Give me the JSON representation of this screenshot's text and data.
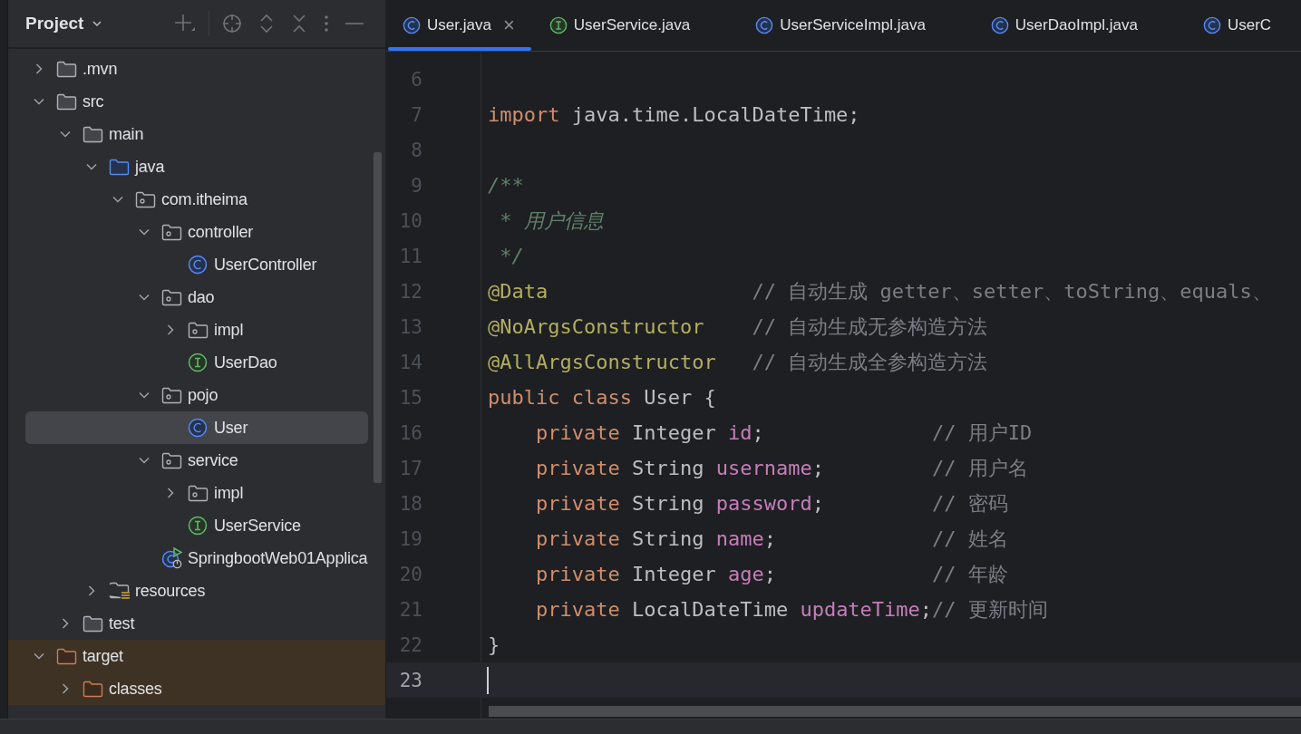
{
  "sidebar": {
    "title": "Project",
    "tree": [
      {
        "label": ".mvn",
        "kind": "folder",
        "expanded": false,
        "selected": false,
        "excluded": false
      },
      {
        "label": "src",
        "kind": "folder",
        "expanded": true,
        "selected": false,
        "excluded": false,
        "children": [
          {
            "label": "main",
            "kind": "folder",
            "expanded": true,
            "selected": false,
            "excluded": false,
            "children": [
              {
                "label": "java",
                "kind": "source",
                "expanded": true,
                "selected": false,
                "excluded": false,
                "children": [
                  {
                    "label": "com.itheima",
                    "kind": "package",
                    "expanded": true,
                    "selected": false,
                    "excluded": false,
                    "children": [
                      {
                        "label": "controller",
                        "kind": "package",
                        "expanded": true,
                        "selected": false,
                        "excluded": false,
                        "children": [
                          {
                            "label": "UserController",
                            "kind": "class",
                            "selected": false,
                            "excluded": false
                          }
                        ]
                      },
                      {
                        "label": "dao",
                        "kind": "package",
                        "expanded": true,
                        "selected": false,
                        "excluded": false,
                        "children": [
                          {
                            "label": "impl",
                            "kind": "package",
                            "expanded": false,
                            "selected": false,
                            "excluded": false
                          },
                          {
                            "label": "UserDao",
                            "kind": "interface",
                            "selected": false,
                            "excluded": false
                          }
                        ]
                      },
                      {
                        "label": "pojo",
                        "kind": "package",
                        "expanded": true,
                        "selected": false,
                        "excluded": false,
                        "children": [
                          {
                            "label": "User",
                            "kind": "class",
                            "selected": true,
                            "excluded": false
                          }
                        ]
                      },
                      {
                        "label": "service",
                        "kind": "package",
                        "expanded": true,
                        "selected": false,
                        "excluded": false,
                        "children": [
                          {
                            "label": "impl",
                            "kind": "package",
                            "expanded": false,
                            "selected": false,
                            "excluded": false
                          },
                          {
                            "label": "UserService",
                            "kind": "interface",
                            "selected": false,
                            "excluded": false
                          }
                        ]
                      },
                      {
                        "label": "SpringbootWeb01Applica",
                        "kind": "app",
                        "selected": false,
                        "excluded": false
                      }
                    ]
                  }
                ]
              },
              {
                "label": "resources",
                "kind": "resources",
                "expanded": false,
                "selected": false,
                "excluded": false
              }
            ]
          },
          {
            "label": "test",
            "kind": "folder",
            "expanded": false,
            "selected": false,
            "excluded": false
          }
        ]
      },
      {
        "label": "target",
        "kind": "folder",
        "expanded": true,
        "selected": false,
        "excluded": true,
        "children": [
          {
            "label": "classes",
            "kind": "folder",
            "expanded": false,
            "selected": false,
            "excluded": true
          }
        ]
      }
    ]
  },
  "tabs": [
    {
      "label": "User.java",
      "kind": "class",
      "selected": true
    },
    {
      "label": "UserService.java",
      "kind": "interface",
      "selected": false
    },
    {
      "label": "UserServiceImpl.java",
      "kind": "class",
      "selected": false
    },
    {
      "label": "UserDaoImpl.java",
      "kind": "class",
      "selected": false
    },
    {
      "label": "UserC",
      "kind": "class",
      "selected": false
    }
  ],
  "close_icon": "×",
  "editor": {
    "lines": [
      {
        "number": "6",
        "current": false
      },
      {
        "number": "7",
        "current": false,
        "tokens": [
          {
            "text": "import",
            "kind": "keyword"
          },
          {
            "text": " java.time.LocalDateTime;",
            "kind": "plain"
          }
        ]
      },
      {
        "number": "8",
        "current": false
      },
      {
        "number": "9",
        "current": false,
        "tokens": [
          {
            "text": "/**",
            "kind": "doc"
          }
        ]
      },
      {
        "number": "10",
        "current": false,
        "tokens": [
          {
            "text": " * 用户信息",
            "kind": "doc"
          }
        ]
      },
      {
        "number": "11",
        "current": false,
        "tokens": [
          {
            "text": " */",
            "kind": "doc"
          }
        ]
      },
      {
        "number": "12",
        "current": false,
        "tokens": [
          {
            "text": "@Data                 ",
            "kind": "annotation"
          },
          {
            "text": "// 自动生成 getter、setter、toString、equals、",
            "kind": "comment"
          }
        ]
      },
      {
        "number": "13",
        "current": false,
        "tokens": [
          {
            "text": "@NoArgsConstructor    ",
            "kind": "annotation"
          },
          {
            "text": "// 自动生成无参构造方法",
            "kind": "comment"
          }
        ]
      },
      {
        "number": "14",
        "current": false,
        "tokens": [
          {
            "text": "@AllArgsConstructor   ",
            "kind": "annotation"
          },
          {
            "text": "// 自动生成全参构造方法",
            "kind": "comment"
          }
        ]
      },
      {
        "number": "15",
        "current": false,
        "tokens": [
          {
            "text": "public class",
            "kind": "keyword"
          },
          {
            "text": " User {",
            "kind": "plain"
          }
        ]
      },
      {
        "number": "16",
        "current": false,
        "tokens": [
          {
            "text": "    private",
            "kind": "keyword"
          },
          {
            "text": " Integer ",
            "kind": "plain"
          },
          {
            "text": "id",
            "kind": "field"
          },
          {
            "text": ";              ",
            "kind": "plain"
          },
          {
            "text": "// 用户ID",
            "kind": "comment"
          }
        ]
      },
      {
        "number": "17",
        "current": false,
        "tokens": [
          {
            "text": "    private",
            "kind": "keyword"
          },
          {
            "text": " String ",
            "kind": "plain"
          },
          {
            "text": "username",
            "kind": "field"
          },
          {
            "text": ";         ",
            "kind": "plain"
          },
          {
            "text": "// 用户名",
            "kind": "comment"
          }
        ]
      },
      {
        "number": "18",
        "current": false,
        "tokens": [
          {
            "text": "    private",
            "kind": "keyword"
          },
          {
            "text": " String ",
            "kind": "plain"
          },
          {
            "text": "password",
            "kind": "field"
          },
          {
            "text": ";         ",
            "kind": "plain"
          },
          {
            "text": "// 密码",
            "kind": "comment"
          }
        ]
      },
      {
        "number": "19",
        "current": false,
        "tokens": [
          {
            "text": "    private",
            "kind": "keyword"
          },
          {
            "text": " String ",
            "kind": "plain"
          },
          {
            "text": "name",
            "kind": "field"
          },
          {
            "text": ";             ",
            "kind": "plain"
          },
          {
            "text": "// 姓名",
            "kind": "comment"
          }
        ]
      },
      {
        "number": "20",
        "current": false,
        "tokens": [
          {
            "text": "    private",
            "kind": "keyword"
          },
          {
            "text": " Integer ",
            "kind": "plain"
          },
          {
            "text": "age",
            "kind": "field"
          },
          {
            "text": ";             ",
            "kind": "plain"
          },
          {
            "text": "// 年龄",
            "kind": "comment"
          }
        ]
      },
      {
        "number": "21",
        "current": false,
        "tokens": [
          {
            "text": "    private",
            "kind": "keyword"
          },
          {
            "text": " LocalDateTime ",
            "kind": "plain"
          },
          {
            "text": "updateTime",
            "kind": "field"
          },
          {
            "text": ";",
            "kind": "plain"
          },
          {
            "text": "// 更新时间",
            "kind": "comment"
          }
        ]
      },
      {
        "number": "22",
        "current": false,
        "tokens": [
          {
            "text": "}",
            "kind": "plain"
          }
        ]
      },
      {
        "number": "23",
        "current": true
      }
    ]
  }
}
